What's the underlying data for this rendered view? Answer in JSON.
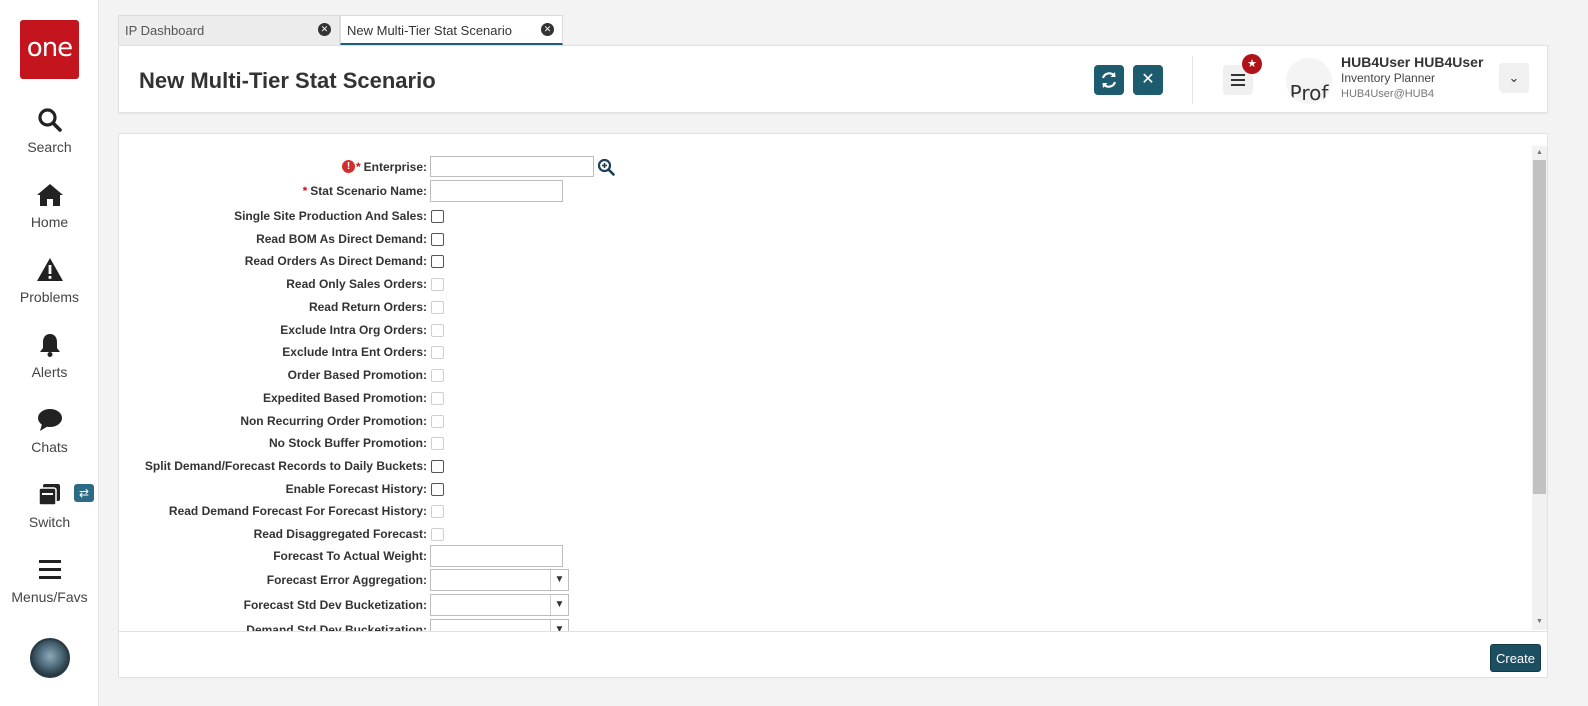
{
  "brand": {
    "logo_text": "one",
    "logo_color": "#c4141d",
    "accent": "#1d5c6e"
  },
  "nav": {
    "items": [
      {
        "label": "Search",
        "icon": "search-icon"
      },
      {
        "label": "Home",
        "icon": "home-icon"
      },
      {
        "label": "Problems",
        "icon": "warning-icon"
      },
      {
        "label": "Alerts",
        "icon": "bell-icon"
      },
      {
        "label": "Chats",
        "icon": "chat-icon"
      },
      {
        "label": "Switch",
        "icon": "switch-icon"
      },
      {
        "label": "Menus/Favs",
        "icon": "hamburger-icon"
      }
    ],
    "switch_badge": "⇄"
  },
  "tabs": [
    {
      "label": "IP Dashboard",
      "active": false
    },
    {
      "label": "New Multi-Tier Stat Scenario",
      "active": true
    }
  ],
  "header": {
    "title": "New Multi-Tier Stat Scenario",
    "refresh_icon": "refresh-icon",
    "close_icon": "close-icon",
    "profile_placeholder": "Prof"
  },
  "user": {
    "name": "HUB4User HUB4User",
    "role": "Inventory Planner",
    "email": "HUB4User@HUB4"
  },
  "form": {
    "enterprise_label": "Enterprise:",
    "enterprise_value": "",
    "scenario_name_label": "Stat Scenario Name:",
    "scenario_name_value": "",
    "required_mark": "*",
    "error_mark": "!",
    "checkboxes": [
      {
        "label": "Single Site Production And Sales:",
        "enabled": true,
        "checked": false
      },
      {
        "label": "Read BOM As Direct Demand:",
        "enabled": true,
        "checked": false
      },
      {
        "label": "Read Orders As Direct Demand:",
        "enabled": true,
        "checked": false
      },
      {
        "label": "Read Only Sales Orders:",
        "enabled": false,
        "checked": false
      },
      {
        "label": "Read Return Orders:",
        "enabled": false,
        "checked": false
      },
      {
        "label": "Exclude Intra Org Orders:",
        "enabled": false,
        "checked": false
      },
      {
        "label": "Exclude Intra Ent Orders:",
        "enabled": false,
        "checked": false
      },
      {
        "label": "Order Based Promotion:",
        "enabled": false,
        "checked": false
      },
      {
        "label": "Expedited Based Promotion:",
        "enabled": false,
        "checked": false
      },
      {
        "label": "Non Recurring Order Promotion:",
        "enabled": false,
        "checked": false
      },
      {
        "label": "No Stock Buffer Promotion:",
        "enabled": false,
        "checked": false
      },
      {
        "label": "Split Demand/Forecast Records to Daily Buckets:",
        "enabled": true,
        "checked": false
      },
      {
        "label": "Enable Forecast History:",
        "enabled": true,
        "checked": false
      },
      {
        "label": "Read Demand Forecast For Forecast History:",
        "enabled": false,
        "checked": false
      },
      {
        "label": "Read Disaggregated Forecast:",
        "enabled": false,
        "checked": false
      }
    ],
    "weight_label": "Forecast To Actual Weight:",
    "weight_value": "",
    "selects": [
      {
        "label": "Forecast Error Aggregation:",
        "value": ""
      },
      {
        "label": "Forecast Std Dev Bucketization:",
        "value": ""
      },
      {
        "label": "Demand Std Dev Bucketization:",
        "value": ""
      }
    ]
  },
  "footer": {
    "create_label": "Create"
  }
}
